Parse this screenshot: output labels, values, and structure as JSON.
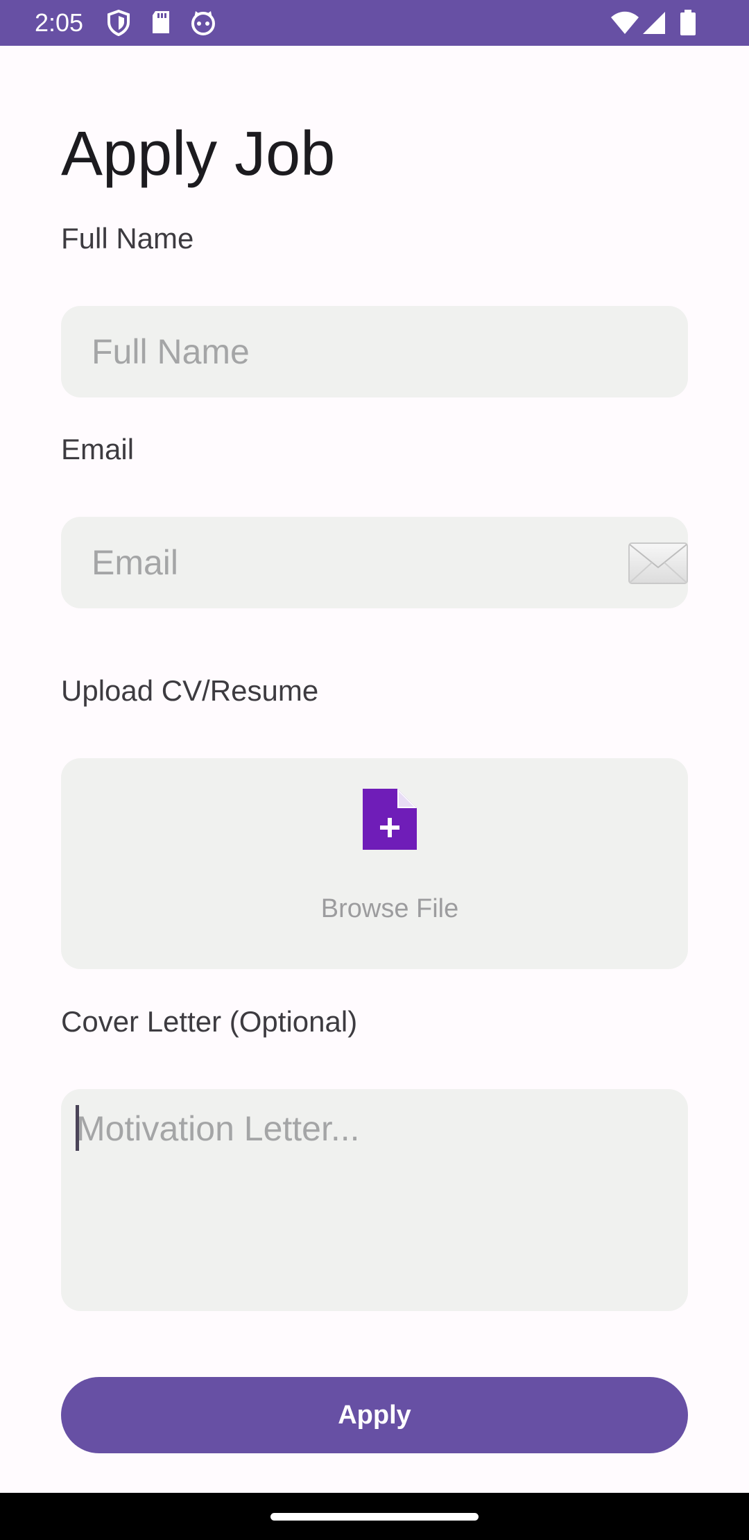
{
  "status_bar": {
    "time": "2:05",
    "left_icons": [
      "shield-icon",
      "sd-card-icon",
      "cat-face-icon"
    ],
    "right_icons": [
      "wifi-icon",
      "signal-icon",
      "battery-icon"
    ]
  },
  "page": {
    "title": "Apply Job"
  },
  "form": {
    "full_name": {
      "label": "Full Name",
      "placeholder": "Full Name",
      "value": ""
    },
    "email": {
      "label": "Email",
      "placeholder": "Email",
      "value": "",
      "icon": "envelope-icon"
    },
    "cv": {
      "label": "Upload CV/Resume",
      "browse_text": "Browse File",
      "icon": "file-add-icon"
    },
    "cover_letter": {
      "label": "Cover Letter (Optional)",
      "placeholder": "Motivation Letter...",
      "value": ""
    },
    "submit_label": "Apply"
  },
  "colors": {
    "primary": "#6750A4",
    "upload_icon": "#6F1DB8",
    "field_bg": "#F0F1EF",
    "page_bg": "#FFFBFE"
  }
}
